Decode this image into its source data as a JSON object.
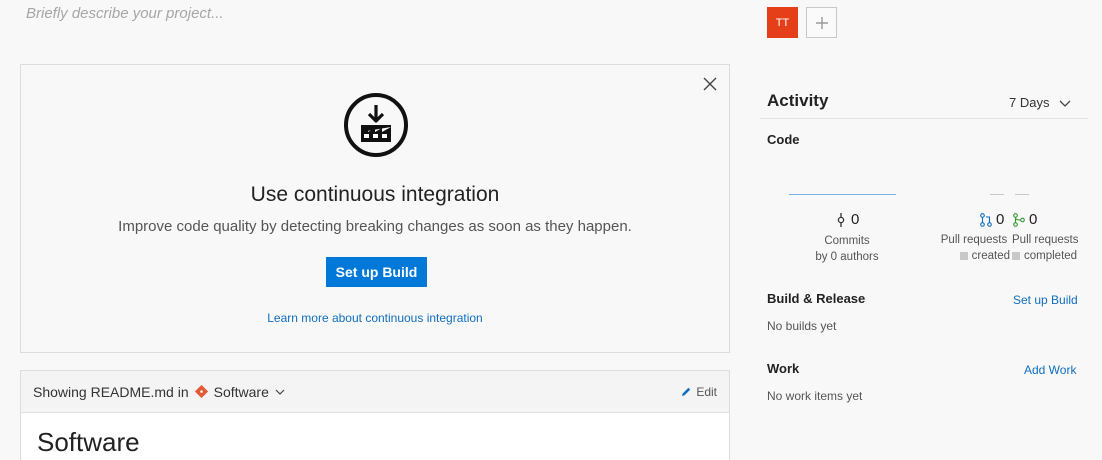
{
  "project": {
    "description_placeholder": "Briefly describe your project..."
  },
  "ci_card": {
    "title": "Use continuous integration",
    "subtitle": "Improve code quality by detecting breaking changes as soon as they happen.",
    "button_label": "Set up Build",
    "learn_link": "Learn more about continuous integration"
  },
  "readme": {
    "showing_prefix": "Showing README.md in",
    "repo_name": "Software",
    "edit_label": "Edit",
    "title": "Software"
  },
  "members": {
    "avatar_initials": "TT",
    "avatar_color": "#e43f19"
  },
  "activity": {
    "title": "Activity",
    "range": "7 Days",
    "code": {
      "label": "Code",
      "commits_count": "0",
      "commits_label": "Commits",
      "commits_sub": "by 0 authors",
      "pr_created_count": "0",
      "pr_created_label": "Pull requests",
      "pr_created_sub": "created",
      "pr_completed_count": "0",
      "pr_completed_label": "Pull requests",
      "pr_completed_sub": "completed"
    },
    "build_release": {
      "label": "Build & Release",
      "action": "Set up Build",
      "status": "No builds yet"
    },
    "work": {
      "label": "Work",
      "action": "Add Work",
      "status": "No work items yet"
    }
  },
  "colors": {
    "accent": "#0078d7",
    "link": "#106ebe"
  }
}
